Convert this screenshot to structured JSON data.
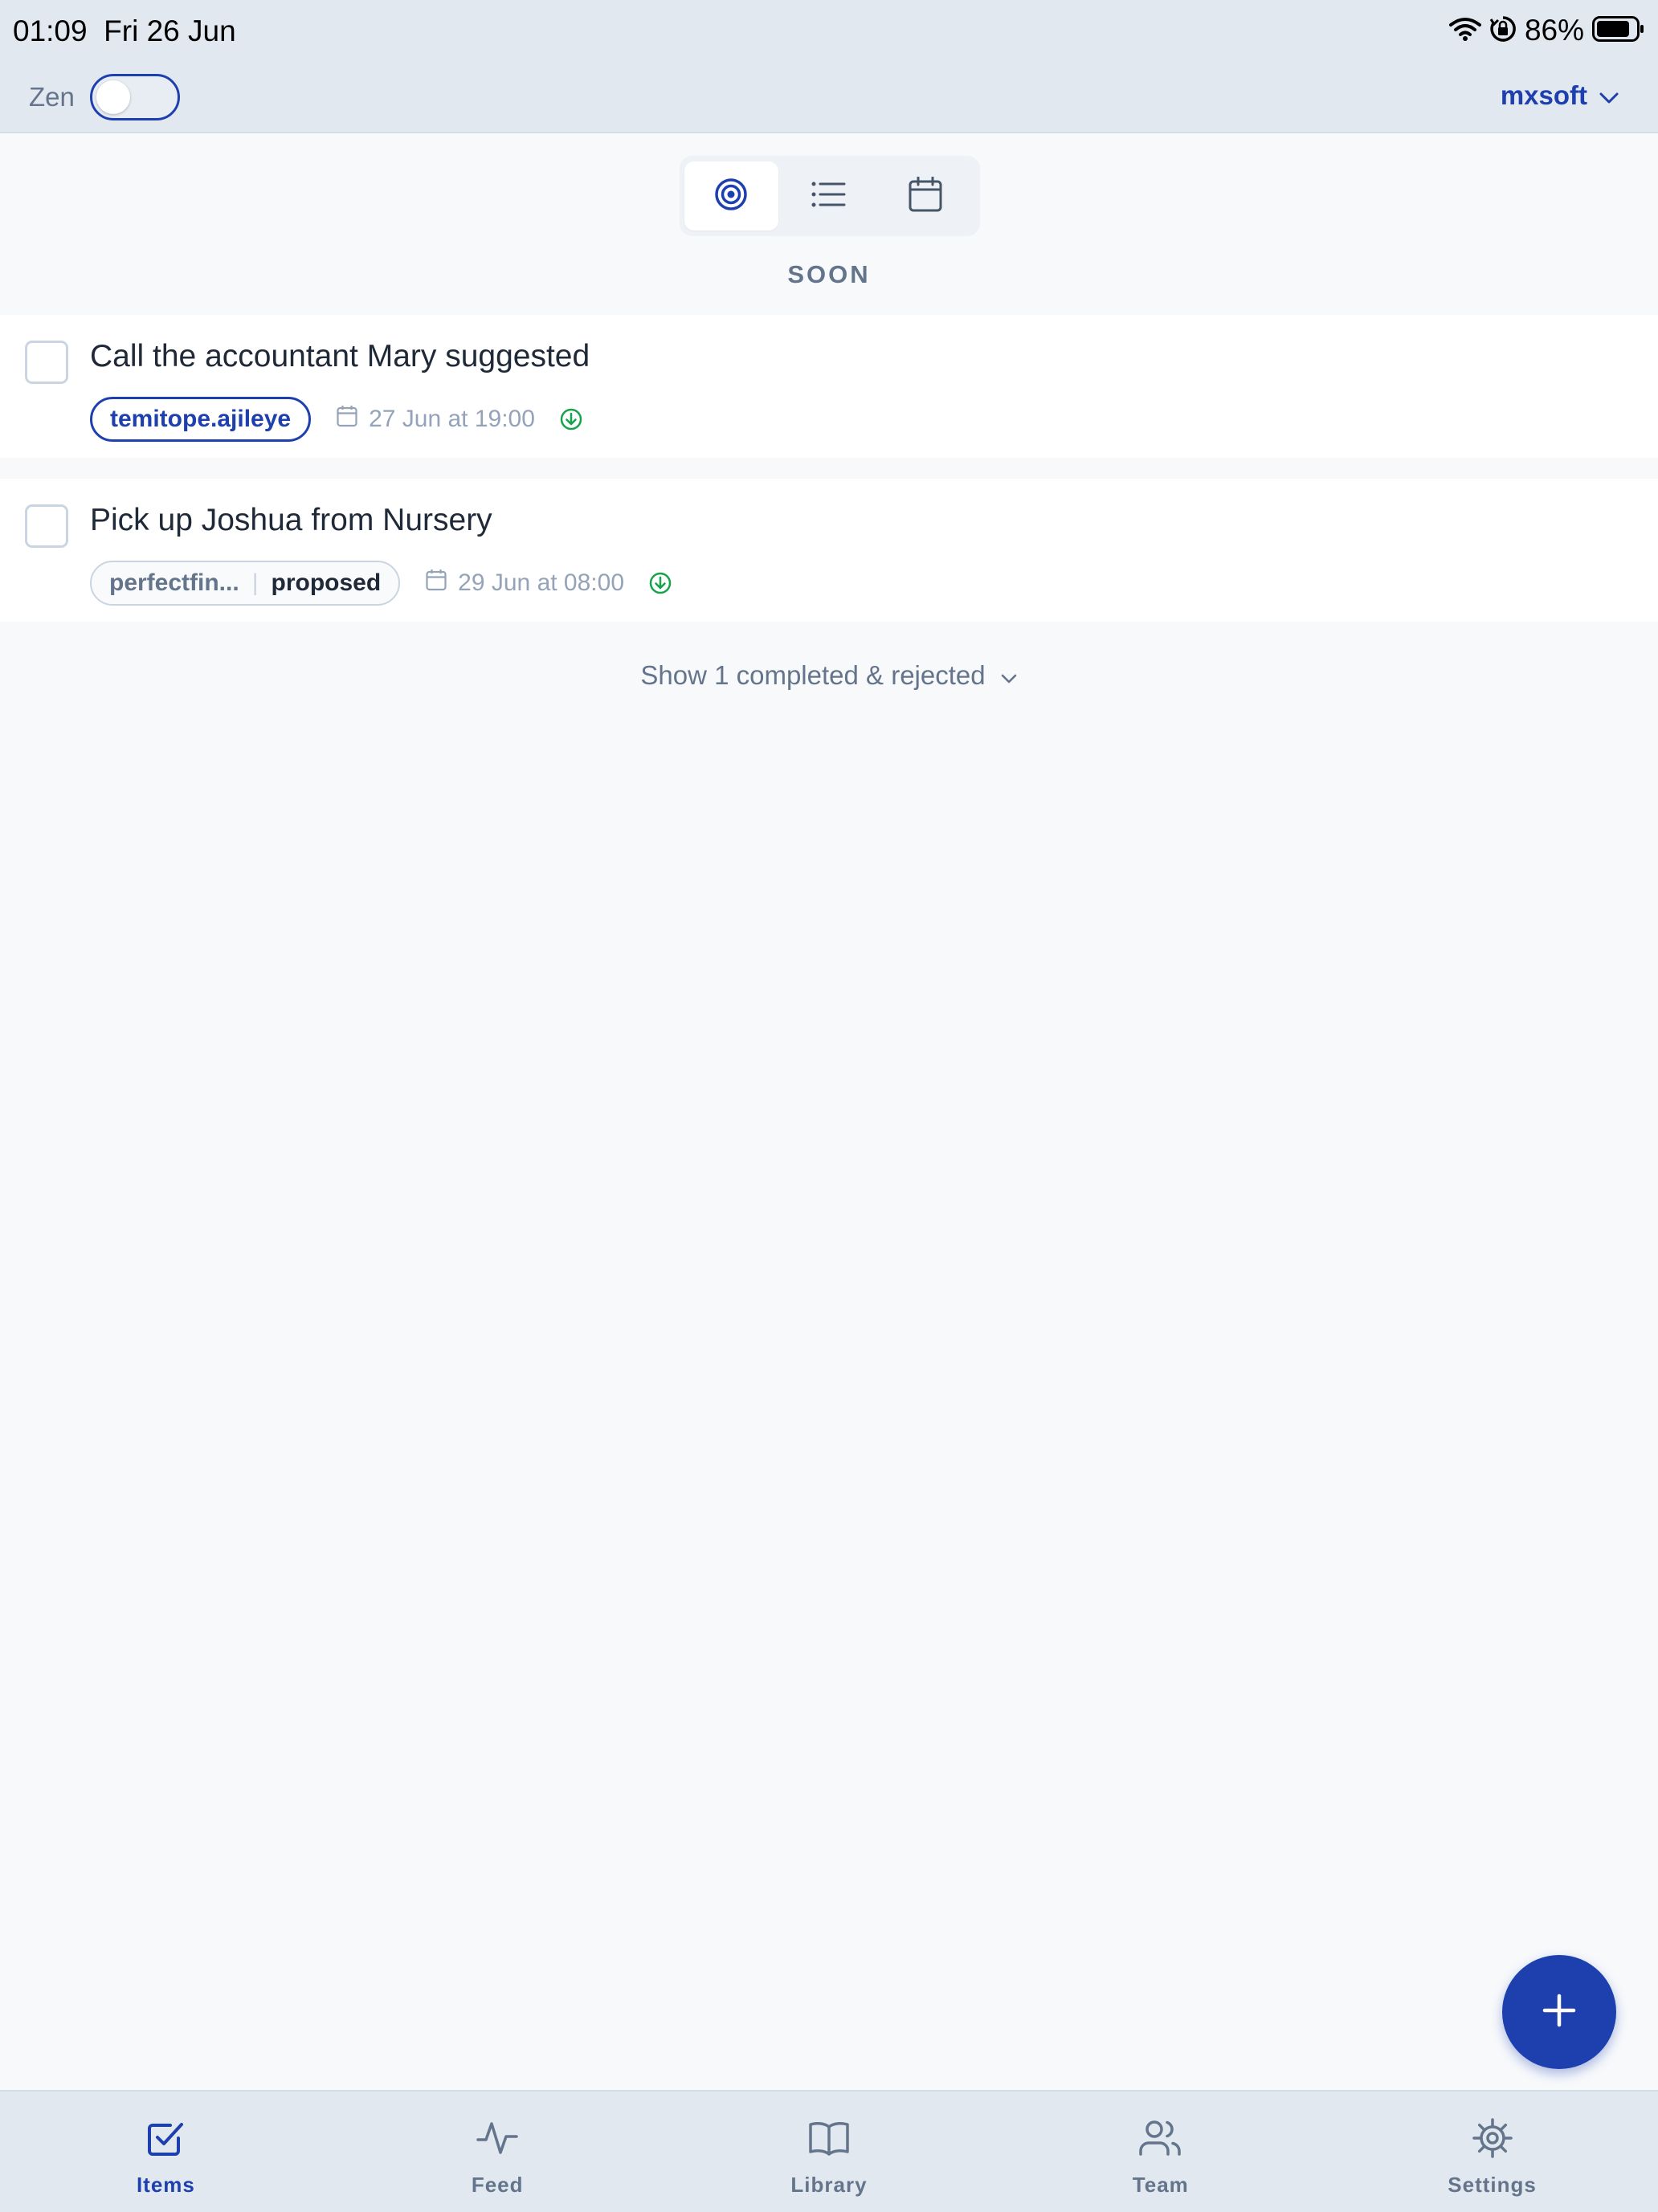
{
  "status_bar": {
    "time": "01:09",
    "date": "Fri 26 Jun",
    "battery_percent": "86%",
    "battery_level": 0.86
  },
  "header": {
    "zen_label": "Zen",
    "zen_enabled": false,
    "workspace": "mxsoft"
  },
  "view_switcher": {
    "views": [
      {
        "icon": "target-icon",
        "active": true
      },
      {
        "icon": "list-icon",
        "active": false
      },
      {
        "icon": "calendar-icon",
        "active": false
      }
    ]
  },
  "section": {
    "title": "SOON"
  },
  "tasks": [
    {
      "title": "Call the accountant Mary suggested",
      "tag": "temitope.ajileye",
      "due": "27 Jun at 19:00",
      "completed": false
    },
    {
      "title": "Pick up Joshua from Nursery",
      "tag": "perfectfin...",
      "tag_state": "proposed",
      "due": "29 Jun at 08:00",
      "completed": false
    }
  ],
  "show_completed_label": "Show 1 completed & rejected",
  "tabs": [
    {
      "label": "Items",
      "icon": "items-check-icon",
      "active": true
    },
    {
      "label": "Feed",
      "icon": "activity-icon",
      "active": false
    },
    {
      "label": "Library",
      "icon": "book-icon",
      "active": false
    },
    {
      "label": "Team",
      "icon": "users-icon",
      "active": false
    },
    {
      "label": "Settings",
      "icon": "gear-icon",
      "active": false
    }
  ],
  "colors": {
    "accent": "#1e40af",
    "success": "#16a34a",
    "muted": "#64748b",
    "bar_background": "#e2e8f0",
    "page_background": "#f7f9fb"
  }
}
